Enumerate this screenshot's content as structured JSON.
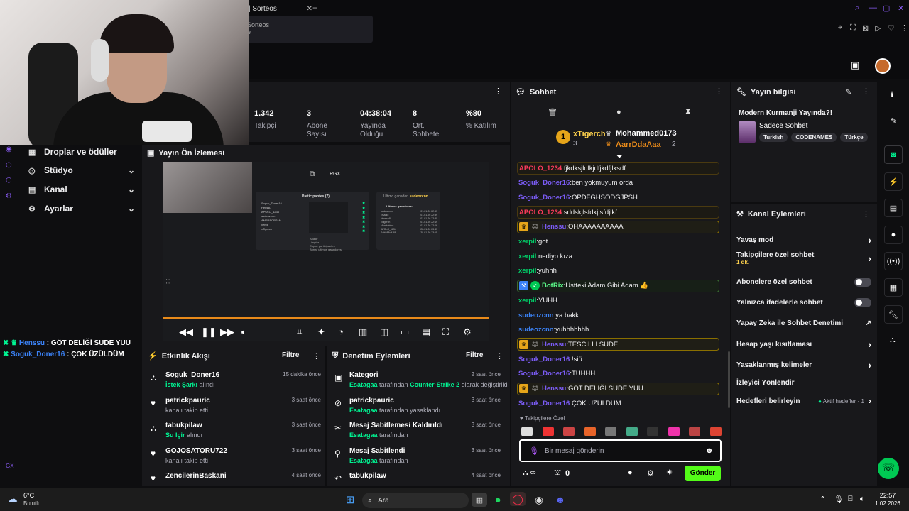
{
  "browser": {
    "tab_title": "| Sorteos",
    "tab_close": "✕",
    "new_tab": "+",
    "dropdown_text": "Sorteos",
    "dropdown_sub": "e"
  },
  "nav": {
    "items": [
      {
        "label": "Droplar ve ödüller",
        "icon": "gift-icon"
      },
      {
        "label": "Stüdyo",
        "icon": "studio-icon"
      },
      {
        "label": "Kanal",
        "icon": "channel-icon"
      },
      {
        "label": "Ayarlar",
        "icon": "gear-icon"
      }
    ]
  },
  "overlay_chat": [
    {
      "name": "Henssu",
      "text": "GÖT DELİĞİ SUDE YUU"
    },
    {
      "name": "Soguk_Doner16",
      "text": "ÇOK ÜZÜLDÜM"
    }
  ],
  "overlay_gx": "GX",
  "stats": [
    {
      "value": "1.342",
      "label": "Takipçi"
    },
    {
      "value": "3",
      "label": "Abone Sayısı"
    },
    {
      "value": "04:38:04",
      "label": "Yayında Olduğu"
    },
    {
      "value": "8",
      "label": "Ort. Sohbete"
    },
    {
      "value": "%80",
      "label": "% Katılım"
    }
  ],
  "preview": {
    "title": "Yayın Ön İzlemesi",
    "rgx": "RGX",
    "participants_title": "Participantes (7)",
    "last_winner_label": "Ultimo ganador:",
    "last_winner": "sudeozcnn",
    "last_winners_title": "Ultimos ganadores:",
    "participants": [
      "Soguk_Doner16",
      "Henssu",
      "APOLO_1234",
      "sudeozcnn",
      "AMRAFORTAN",
      "xerpil",
      "xTigerch"
    ],
    "menu": [
      "Añadir",
      "Limpiar",
      "Copiar participantes",
      "Borrar ultimos ganadores"
    ],
    "winners": [
      [
        "sudeozcnn",
        "01-01-26 22:57"
      ],
      [
        "crsaoio",
        "01-01-26 22:39"
      ],
      [
        "Henssu8",
        "01-01-26 22:30"
      ],
      [
        "xTigerch",
        "01-01-26 22:19"
      ],
      [
        "Membabine",
        "01-01-26 22:06"
      ],
      [
        "APOLO_1234",
        "28-01-26 23:47"
      ],
      [
        "Soltiz88off 58",
        "28-01-26 23:15"
      ]
    ]
  },
  "activity": {
    "title": "Etkinlik Akışı",
    "filter": "Filtre",
    "items": [
      {
        "name": "Soguk_Doner16",
        "sub_green": "İstek Şarkı",
        "sub": " alındı",
        "time": "15 dakika önce"
      },
      {
        "name": "patrickpauric",
        "sub_green": "",
        "sub": "kanalı takip etti",
        "time": "3 saat önce"
      },
      {
        "name": "tabukpilaw",
        "sub_green": "Su İçir",
        "sub": " alındı",
        "time": "3 saat önce"
      },
      {
        "name": "GOJOSATORU722",
        "sub_green": "",
        "sub": "kanalı takip etti",
        "time": "3 saat önce"
      },
      {
        "name": "ZencilerinBaskani",
        "sub_green": "",
        "sub": "",
        "time": "4 saat önce"
      }
    ]
  },
  "modlog": {
    "title": "Denetim Eylemleri",
    "filter": "Filtre",
    "items": [
      {
        "name": "Kategori",
        "actor": "Esatagaa",
        "mid": " tarafından ",
        "extra": "Counter-Strike 2",
        "tail": " olarak değiştirildi",
        "time": "2 saat önce"
      },
      {
        "name": "patrickpauric",
        "actor": "Esatagaa",
        "mid": " tarafından yasaklandı",
        "extra": "",
        "tail": "",
        "time": "3 saat önce"
      },
      {
        "name": "Mesaj Sabitlemesi Kaldırıldı",
        "actor": "Esatagaa",
        "mid": " tarafından",
        "extra": "",
        "tail": "",
        "time": "3 saat önce"
      },
      {
        "name": "Mesaj Sabitlendi",
        "actor": "Esatagaa",
        "mid": " tarafından",
        "extra": "",
        "tail": "",
        "time": "3 saat önce"
      },
      {
        "name": "tabukpilaw",
        "actor": "",
        "mid": "",
        "extra": "",
        "tail": "",
        "time": "4 saat önce"
      }
    ]
  },
  "chat": {
    "title": "Sohbet",
    "leader1_name": "xTigerch",
    "leader1_count": "3",
    "leader1_rank": "1",
    "leader2_name": "Mohammed0173",
    "leader2_count": "2",
    "leader3_name": "AarrDdaAaa",
    "leader3_count": "2",
    "messages": [
      {
        "name": "APOLO_1234",
        "text": "fjkdksjldlkjdfjkdfjlksdf",
        "color": "red",
        "style": "hlr"
      },
      {
        "name": "Soguk_Doner16",
        "text": "ben yokmuyum orda",
        "color": "purple",
        "style": ""
      },
      {
        "name": "Soguk_Doner16",
        "text": "OPDFGHSODGJPSH",
        "color": "purple",
        "style": ""
      },
      {
        "name": "APOLO_1234",
        "text": "sddskjlsfdkjlsfdjlkf",
        "color": "red",
        "style": "hlr"
      },
      {
        "name": "Henssu",
        "text": "OHAAAAAAAAAA",
        "color": "purple",
        "style": "hl"
      },
      {
        "name": "xerpil",
        "text": "got",
        "color": "green",
        "style": ""
      },
      {
        "name": "xerpil",
        "text": "nediyo kıza",
        "color": "green",
        "style": ""
      },
      {
        "name": "xerpil",
        "text": "yuhhh",
        "color": "green",
        "style": ""
      },
      {
        "name": "BotRix",
        "text": "Üstteki Adam Gibi Adam 👍",
        "color": "green2",
        "style": "hlg"
      },
      {
        "name": "xerpil",
        "text": "YUHH",
        "color": "green",
        "style": ""
      },
      {
        "name": "sudeozcnn",
        "text": "ya bakk",
        "color": "blue",
        "style": ""
      },
      {
        "name": "sudeozcnn",
        "text": "yuhhhhhhh",
        "color": "blue",
        "style": ""
      },
      {
        "name": "Henssu",
        "text": "TESCİLLİ SUDE",
        "color": "purple",
        "style": "hl"
      },
      {
        "name": "Soguk_Doner16",
        "text": "!siü",
        "color": "purple",
        "style": ""
      },
      {
        "name": "Soguk_Doner16",
        "text": "TÜHHH",
        "color": "purple",
        "style": ""
      },
      {
        "name": "Henssu",
        "text": "GÖT DELİĞİ SUDE YUU",
        "color": "purple",
        "style": "hl"
      },
      {
        "name": "Soguk_Doner16",
        "text": "ÇOK ÜZÜLDÜM",
        "color": "purple",
        "style": ""
      }
    ],
    "followers_only": "Takipçilere Özel",
    "input_placeholder": "Bir mesaj gönderin",
    "points": "0",
    "send": "Gönder"
  },
  "info": {
    "title": "Yayın bilgisi",
    "stream_title": "Modern Kurmanji Yayında?!",
    "category": "Sadece Sohbet",
    "tags": [
      "Turkish",
      "CODENAMES",
      "Türkçe"
    ]
  },
  "channel_actions": {
    "title": "Kanal Eylemleri",
    "items": [
      {
        "label": "Yavaş mod",
        "kind": "chevron"
      },
      {
        "label": "Takipçilere özel sohbet",
        "kind": "chevron",
        "sub": "1 dk."
      },
      {
        "label": "Abonelere özel sohbet",
        "kind": "toggle"
      },
      {
        "label": "Yalnızca ifadelerle sohbet",
        "kind": "toggle"
      },
      {
        "label": "Yapay Zeka ile Sohbet Denetimi",
        "kind": "external"
      },
      {
        "label": "Hesap yaşı kısıtlaması",
        "kind": "chevron"
      },
      {
        "label": "Yasaklanmış kelimeler",
        "kind": "chevron"
      },
      {
        "label": "İzleyici Yönlendir",
        "kind": "none"
      },
      {
        "label": "Hedefleri belirleyin",
        "kind": "chevron",
        "extra": "Aktif hedefler - 1"
      }
    ]
  },
  "taskbar": {
    "weather_temp": "6°C",
    "weather_desc": "Bulutlu",
    "search": "Ara",
    "time": "22:57",
    "date": "1.02.2026"
  },
  "colors": {
    "accent": "#00f593",
    "purple": "#8a5cf5",
    "bg": "#0e0e10",
    "panel": "#18181b"
  }
}
